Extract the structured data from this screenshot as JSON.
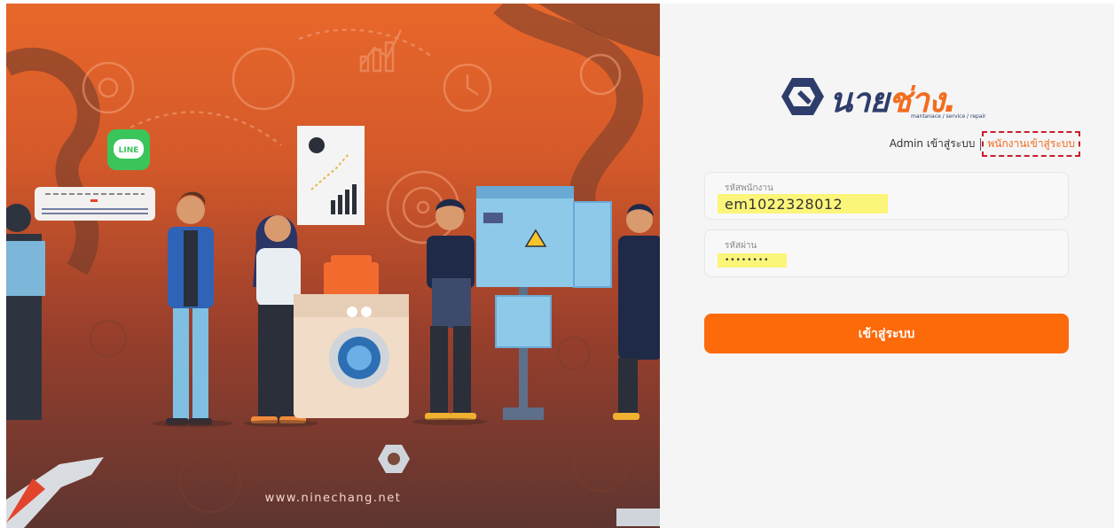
{
  "hero": {
    "website": "www.ninechang.net",
    "line_badge": "LINE"
  },
  "brand": {
    "name_main": "นาย",
    "name_accent": "ช่าง.",
    "tagline": "mantanace / service / repair"
  },
  "login_mode": {
    "admin_label": "Admin เข้าสู่ระบบ",
    "staff_label": "พนักงานเข้าสู่ระบบ",
    "active": "staff"
  },
  "form": {
    "username": {
      "label": "รหัสพนักงาน",
      "value": "em1022328012"
    },
    "password": {
      "label": "รหัสผ่าน",
      "value": "••••••••"
    },
    "submit_label": "เข้าสู่ระบบ"
  },
  "colors": {
    "accent": "#fd6a0a",
    "brand_navy": "#2e3d6b",
    "highlight": "#fbf57a",
    "dashed_outline": "#c91f2a"
  }
}
